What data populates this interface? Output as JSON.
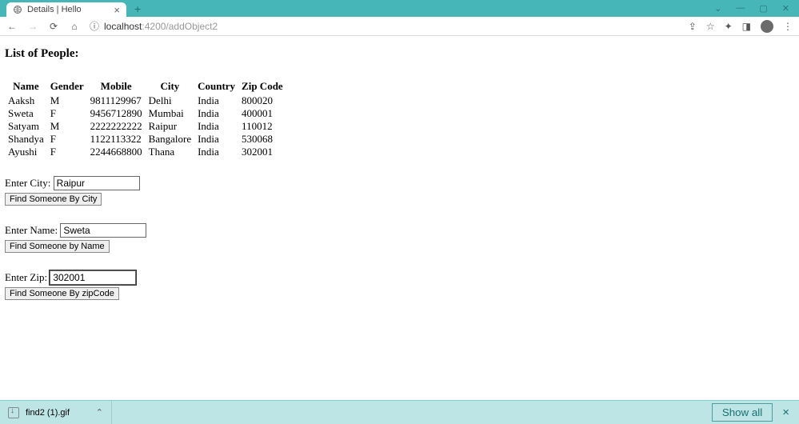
{
  "browser": {
    "tab_title": "Details | Hello",
    "url_protocol_icon": "ⓘ",
    "url_host": "localhost",
    "url_port_path": ":4200/addObject2",
    "download_item": "find2 (1).gif",
    "show_all": "Show all"
  },
  "page": {
    "heading": "List of People:",
    "table": {
      "headers": [
        "Name",
        "Gender",
        "Mobile",
        "City",
        "Country",
        "Zip Code"
      ],
      "rows": [
        [
          "Aaksh",
          "M",
          "9811129967",
          "Delhi",
          "India",
          "800020"
        ],
        [
          "Sweta",
          "F",
          "9456712890",
          "Mumbai",
          "India",
          "400001"
        ],
        [
          "Satyam",
          "M",
          "2222222222",
          "Raipur",
          "India",
          "110012"
        ],
        [
          "Shandya",
          "F",
          "1122113322",
          "Bangalore",
          "India",
          "530068"
        ],
        [
          "Ayushi",
          "F",
          "2244668800",
          "Thana",
          "India",
          "302001"
        ]
      ]
    },
    "form_city": {
      "label": "Enter City:",
      "value": "Raipur",
      "button": "Find Someone By City"
    },
    "form_name": {
      "label": "Enter Name:",
      "value": "Sweta",
      "button": "Find Someone by Name"
    },
    "form_zip": {
      "label": "Enter Zip:",
      "value": "302001",
      "button": "Find Someone By zipCode"
    }
  }
}
